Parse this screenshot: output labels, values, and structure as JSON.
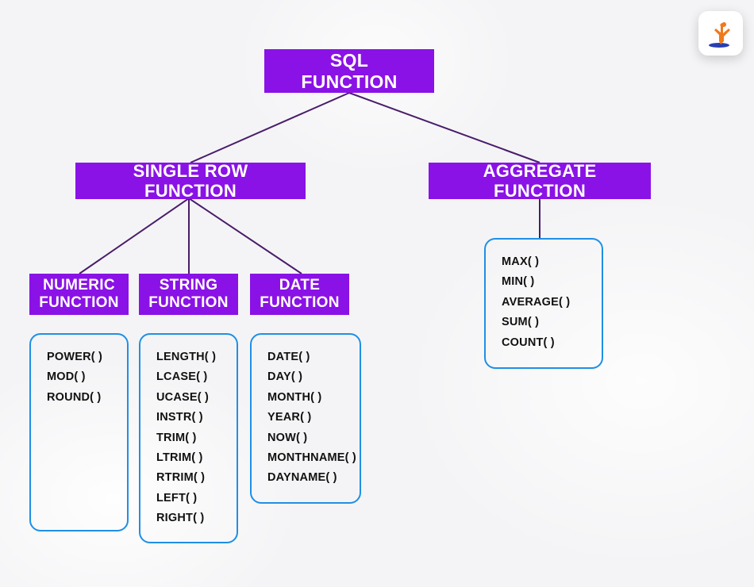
{
  "colors": {
    "accent": "#8a12e6",
    "box_border": "#1f8fe6",
    "connector": "#4a1d6b"
  },
  "root": {
    "label": "SQL FUNCTION"
  },
  "branches": {
    "single_row": {
      "label": "SINGLE ROW FUNCTION",
      "children": {
        "numeric": {
          "label": "NUMERIC FUNCTION",
          "items": [
            "POWER( )",
            "MOD( )",
            "ROUND( )"
          ]
        },
        "string": {
          "label": "STRING FUNCTION",
          "items": [
            "LENGTH( )",
            "LCASE( )",
            "UCASE( )",
            "INSTR( )",
            "TRIM( )",
            "LTRIM( )",
            "RTRIM( )",
            "LEFT( )",
            "RIGHT( )"
          ]
        },
        "date": {
          "label": "DATE FUNCTION",
          "items": [
            "DATE( )",
            "DAY( )",
            "MONTH( )",
            "YEAR( )",
            "NOW( )",
            "MONTHNAME( )",
            "DAYNAME( )"
          ]
        }
      }
    },
    "aggregate": {
      "label": "AGGREGATE FUNCTION",
      "items": [
        "MAX( )",
        "MIN( )",
        "AVERAGE( )",
        "SUM( )",
        "COUNT( )"
      ]
    }
  },
  "logo": {
    "name": "brand-logo"
  }
}
